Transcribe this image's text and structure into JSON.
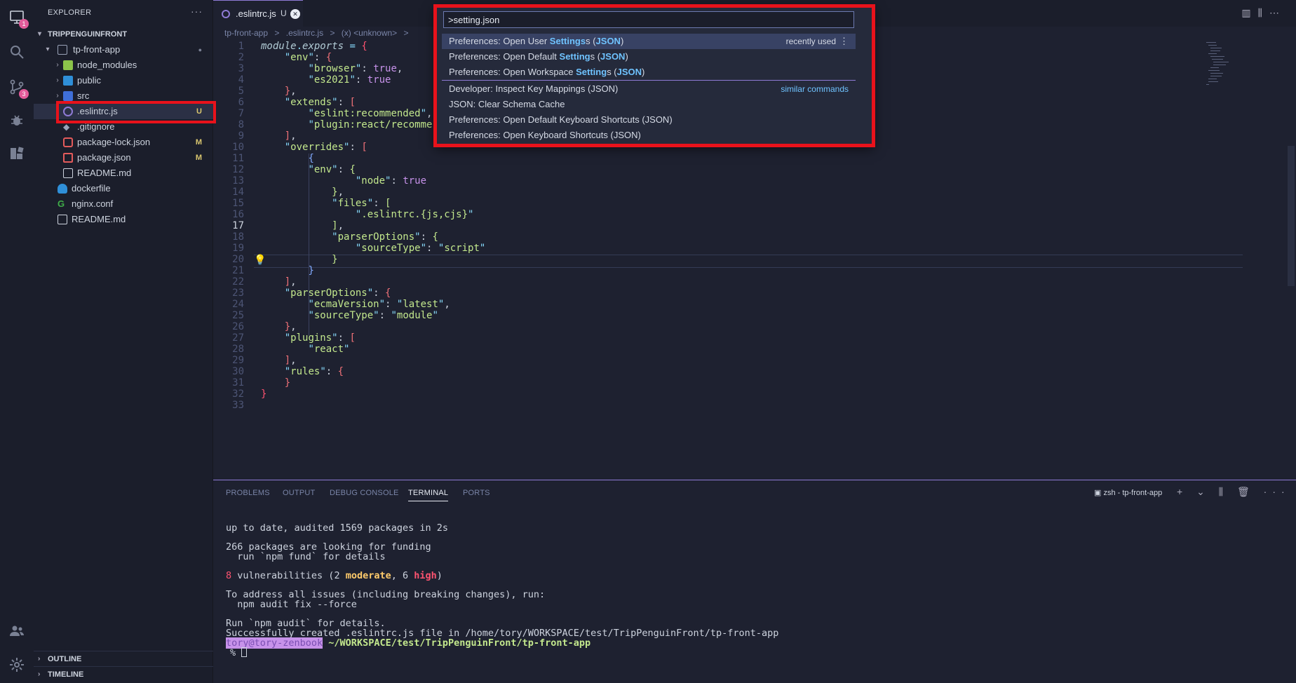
{
  "activity_bar": {
    "remote_badge": "1",
    "scm_badge": "3"
  },
  "sidebar": {
    "title": "EXPLORER",
    "more": "···",
    "workspace": "TRIPPENGUINFRONT",
    "tree": [
      {
        "label": "tp-front-app",
        "git": "●"
      },
      {
        "label": "node_modules",
        "git": ""
      },
      {
        "label": "public",
        "git": ""
      },
      {
        "label": "src",
        "git": ""
      },
      {
        "label": ".eslintrc.js",
        "git": "U"
      },
      {
        "label": ".gitignore",
        "git": ""
      },
      {
        "label": "package-lock.json",
        "git": "M"
      },
      {
        "label": "package.json",
        "git": "M"
      },
      {
        "label": "README.md",
        "git": ""
      },
      {
        "label": "dockerfile",
        "git": ""
      },
      {
        "label": "nginx.conf",
        "git": ""
      },
      {
        "label": "README.md",
        "git": ""
      }
    ],
    "outline": "OUTLINE",
    "timeline": "TIMELINE"
  },
  "editor": {
    "tab": {
      "name": ".eslintrc.js",
      "status": "U"
    },
    "breadcrumb": [
      "tp-front-app",
      ">",
      ".eslintrc.js",
      ">",
      "(x) <unknown>",
      ">"
    ],
    "line_numbers": [
      "1",
      "2",
      "3",
      "4",
      "5",
      "6",
      "7",
      "8",
      "9",
      "10",
      "11",
      "12",
      "13",
      "14",
      "15",
      "16",
      "17",
      "18",
      "19",
      "20",
      "21",
      "22",
      "23",
      "24",
      "25",
      "26",
      "27",
      "28",
      "29",
      "30",
      "31",
      "32",
      "33"
    ],
    "current_line": "17"
  },
  "command_palette": {
    "input_value": ">setting.json",
    "items": [
      {
        "prefix": "Preferences: Open User ",
        "match": "Settings",
        "mid": "s (",
        "match2": "JSON",
        "suffix": ")",
        "right": "recently used",
        "kebab": "⋮"
      },
      {
        "prefix": "Preferences: Open Default ",
        "match": "Setting",
        "mid": "s (",
        "match2": "JSON",
        "suffix": ")",
        "right": ""
      },
      {
        "prefix": "Preferences: Open Workspace ",
        "match": "Setting",
        "mid": "s (",
        "match2": "JSON",
        "suffix": ")",
        "right": ""
      }
    ],
    "similar": [
      {
        "label": "Developer: Inspect Key Mappings (JSON)",
        "right": "similar commands"
      },
      {
        "label": "JSON: Clear Schema Cache",
        "right": ""
      },
      {
        "label": "Preferences: Open Default Keyboard Shortcuts (JSON)",
        "right": ""
      },
      {
        "label": "Preferences: Open Keyboard Shortcuts (JSON)",
        "right": ""
      }
    ]
  },
  "panel": {
    "tabs": [
      "PROBLEMS",
      "OUTPUT",
      "DEBUG CONSOLE",
      "TERMINAL",
      "PORTS"
    ],
    "active_tab": "TERMINAL",
    "terminal_name": "zsh - tp-front-app",
    "terminal_actions": "+ ⌄ ⫼ 🗑 ··· ⌃ ⊗",
    "lines": {
      "l1": "up to date, audited 1569 packages in 2s",
      "l2": "266 packages are looking for funding",
      "l3": "  run `npm fund` for details",
      "vuln_count": "8",
      "vuln_text": " vulnerabilities (2 ",
      "moderate": "moderate",
      "comma": ", 6 ",
      "high": "high",
      "close": ")",
      "l5": "To address all issues (including breaking changes), run:",
      "l6": "  npm audit fix --force",
      "l7": "Run `npm audit` for details.",
      "l8": "Successfully created .eslintrc.js file in /home/tory/WORKSPACE/test/TripPenguinFront/tp-front-app",
      "prompt_user": "tory@tory-zenbook",
      "prompt_path": " ~/WORKSPACE/test/TripPenguinFront/tp-front-app",
      "prompt_char": "% "
    }
  }
}
